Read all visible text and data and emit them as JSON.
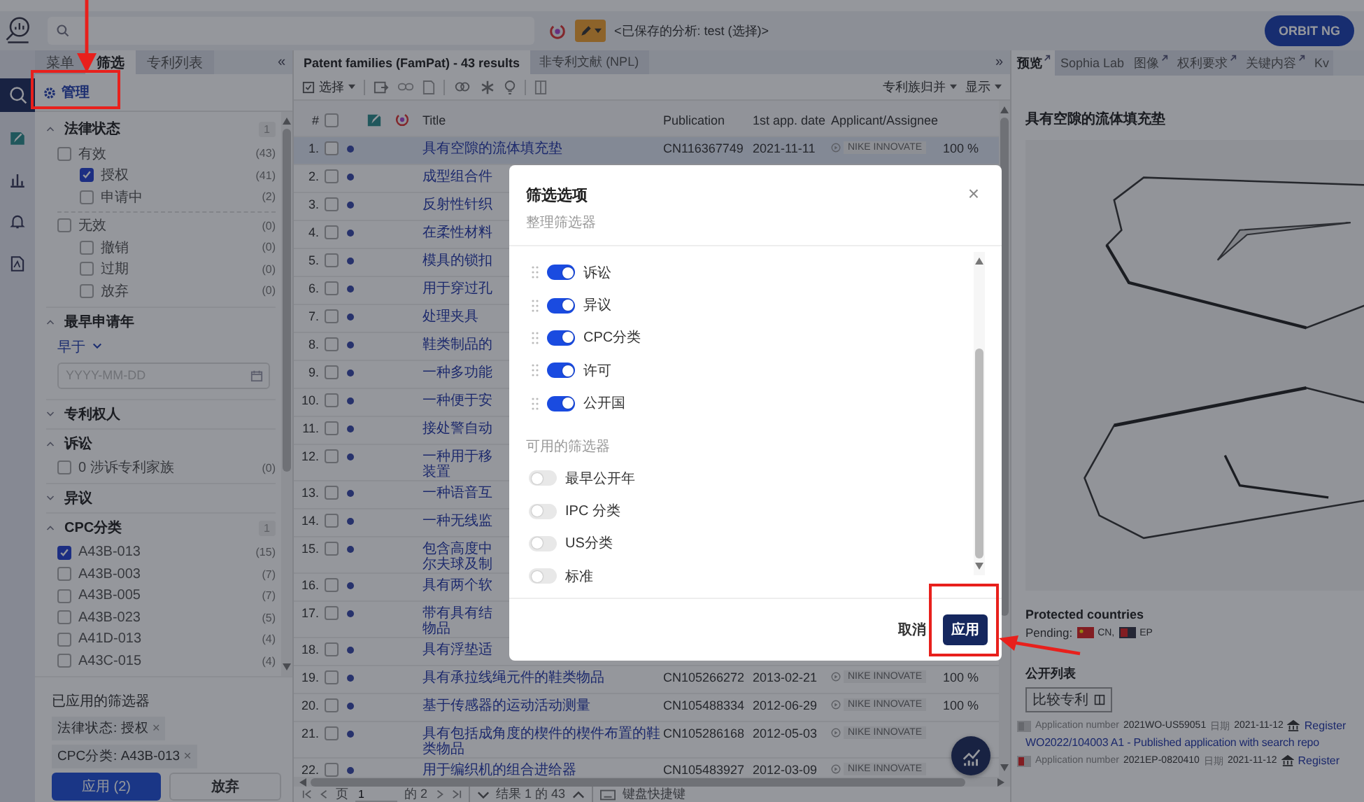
{
  "top_bar": {
    "saved_analysis": "<已保存的分析: test (选择)>",
    "account_button": "ORBIT NG"
  },
  "icon_rail": [
    {
      "selected": true
    },
    {
      "selected": false
    },
    {
      "selected": false
    },
    {
      "selected": false
    },
    {
      "selected": false
    }
  ],
  "filter_panel": {
    "tabs": [
      {
        "label": "菜单",
        "selected": false
      },
      {
        "label": "筛选",
        "selected": true
      },
      {
        "label": "专利列表",
        "selected": false
      }
    ],
    "collapse": "«",
    "manage": {
      "label": "管理",
      "highlighted": true
    },
    "sections": [
      {
        "title": "法律状态",
        "expanded": true,
        "count": "1",
        "kind": "checklist",
        "items": [
          {
            "label": "有效",
            "count": "(43)",
            "checked": false,
            "children": [
              {
                "label": "授权",
                "count": "(41)",
                "checked": true
              },
              {
                "label": "申请中",
                "count": "(2)",
                "checked": false
              }
            ]
          },
          {
            "label": "无效",
            "count": "(0)",
            "checked": false,
            "children": [
              {
                "label": "撤销",
                "count": "(0)",
                "checked": false
              },
              {
                "label": "过期",
                "count": "(0)",
                "checked": false
              },
              {
                "label": "放弃",
                "count": "(0)",
                "checked": false
              }
            ]
          }
        ]
      },
      {
        "title": "最早申请年",
        "expanded": true,
        "kind": "date",
        "mode": "早于",
        "placeholder": "YYYY-MM-DD"
      },
      {
        "title": "专利权人",
        "expanded": false
      },
      {
        "title": "诉讼",
        "expanded": true,
        "kind": "checklist",
        "items": [
          {
            "label": "0 涉诉专利家族",
            "count": "(0)",
            "checked": false
          }
        ]
      },
      {
        "title": "异议",
        "expanded": false
      },
      {
        "title": "CPC分类",
        "expanded": true,
        "count": "1",
        "kind": "checklist",
        "items": [
          {
            "label": "A43B-013",
            "count": "(15)",
            "checked": true
          },
          {
            "label": "A43B-003",
            "count": "(7)",
            "checked": false
          },
          {
            "label": "A43B-005",
            "count": "(7)",
            "checked": false
          },
          {
            "label": "A43B-023",
            "count": "(5)",
            "checked": false
          },
          {
            "label": "A41D-013",
            "count": "(4)",
            "checked": false
          },
          {
            "label": "A43C-015",
            "count": "(4)",
            "checked": false
          }
        ]
      }
    ],
    "applied_title": "已应用的筛选器",
    "applied": [
      {
        "label": "法律状态: 授权",
        "remove": "×"
      },
      {
        "label": "CPC分类: A43B-013",
        "remove": "×"
      }
    ],
    "apply_button": "应用 (2)",
    "discard_button": "放弃"
  },
  "results": {
    "tabs": [
      {
        "label": "Patent families (FamPat) - 43 results",
        "selected": true
      },
      {
        "label": "非专利文献 (NPL)",
        "selected": false
      }
    ],
    "collapse": "»",
    "toolbar": {
      "select": "选择",
      "group": "专利族归并",
      "display": "显示"
    },
    "select_all": {
      "checked": false
    },
    "columns": {
      "number": "#",
      "title": "Title",
      "publication": "Publication",
      "date": "1st app. date",
      "applicant": "Applicant/Assignee"
    },
    "rows": [
      {
        "num": "1.",
        "checked": false,
        "title": "具有空隙的流体填充垫",
        "publication": "CN116367749",
        "date": "2021-11-11",
        "applicant": "NIKE INNOVATE",
        "score": "100 %",
        "selected": true
      },
      {
        "num": "2.",
        "checked": false,
        "title": "成型组合件",
        "selected": false
      },
      {
        "num": "3.",
        "checked": false,
        "title": "反射性针织",
        "selected": false
      },
      {
        "num": "4.",
        "checked": false,
        "title": "在柔性材料",
        "selected": false
      },
      {
        "num": "5.",
        "checked": false,
        "title": "模具的锁扣",
        "selected": false
      },
      {
        "num": "6.",
        "checked": false,
        "title": "用于穿过孔",
        "selected": false
      },
      {
        "num": "7.",
        "checked": false,
        "title": "处理夹具",
        "selected": false
      },
      {
        "num": "8.",
        "checked": false,
        "title": "鞋类制品的",
        "selected": false
      },
      {
        "num": "9.",
        "checked": false,
        "title": "一种多功能",
        "selected": false
      },
      {
        "num": "10.",
        "checked": false,
        "title": "一种便于安",
        "selected": false
      },
      {
        "num": "11.",
        "checked": false,
        "title": "接处警自动",
        "selected": false
      },
      {
        "num": "12.",
        "checked": false,
        "title": "一种用于移装置",
        "selected": false
      },
      {
        "num": "13.",
        "checked": false,
        "title": "一种语音互",
        "selected": false
      },
      {
        "num": "14.",
        "checked": false,
        "title": "一种无线监",
        "selected": false
      },
      {
        "num": "15.",
        "checked": false,
        "title": "包含高度中尔夫球及制",
        "selected": false
      },
      {
        "num": "16.",
        "checked": false,
        "title": "具有两个软",
        "selected": false
      },
      {
        "num": "17.",
        "checked": false,
        "title": "带有具有结物品",
        "selected": false
      },
      {
        "num": "18.",
        "checked": false,
        "title": "具有浮垫适",
        "selected": false
      },
      {
        "num": "19.",
        "checked": false,
        "title": "具有承拉线绳元件的鞋类物品",
        "publication": "CN105266272",
        "date": "2013-02-21",
        "applicant": "NIKE INNOVATE",
        "score": "100 %",
        "selected": false
      },
      {
        "num": "20.",
        "checked": false,
        "title": "基于传感器的运动活动测量",
        "publication": "CN105488334",
        "date": "2012-06-29",
        "applicant": "NIKE INNOVATE",
        "score": "100 %",
        "selected": false
      },
      {
        "num": "21.",
        "checked": false,
        "title": "具有包括成角度的楔件的楔件布置的鞋类物品",
        "publication": "CN105286168",
        "date": "2012-05-03",
        "applicant": "NIKE INNOVATE",
        "selected": false
      },
      {
        "num": "22.",
        "checked": false,
        "title": "用于编织机的组合进给器",
        "publication": "CN105483927",
        "date": "2012-03-09",
        "applicant": "NIKE INNOVATE",
        "selected": false
      }
    ],
    "pagination": {
      "page_label": "页",
      "page": "1",
      "of": "的 2",
      "results": "结果 1 的 43",
      "shortcuts": "键盘快捷键"
    }
  },
  "preview": {
    "tabs": [
      {
        "label": "预览",
        "selected": true,
        "external": true
      },
      {
        "label": "Sophia Lab",
        "selected": false,
        "external": false
      },
      {
        "label": "图像",
        "selected": false,
        "external": true
      },
      {
        "label": "权利要求",
        "selected": false,
        "external": true
      },
      {
        "label": "关键内容",
        "selected": false,
        "external": true
      },
      {
        "label": "Kv",
        "selected": false,
        "external": false
      }
    ],
    "title": "具有空隙的流体填充垫",
    "protected_title": "Protected countries",
    "pending_label": "Pending:",
    "countries": [
      {
        "code": "CN,",
        "kind": "cn"
      },
      {
        "code": "EP",
        "kind": "ep"
      }
    ],
    "publications_title": "公开列表",
    "compare_button": "比较专利",
    "publications": [
      {
        "app_label": "Application number",
        "app_number": "2021WO-US59051",
        "date_label": "日期",
        "date": "2021-11-12",
        "register": "Register",
        "link": "WO2022/104003 A1 - Published application with search repo"
      },
      {
        "app_label": "Application number",
        "app_number": "2021EP-0820410",
        "date_label": "日期",
        "date": "2021-11-12",
        "register": "Register"
      }
    ]
  },
  "dialog": {
    "title": "筛选选项",
    "subtitle": "整理筛选器",
    "close": "×",
    "active": [
      {
        "label": "诉讼",
        "on": true
      },
      {
        "label": "异议",
        "on": true
      },
      {
        "label": "CPC分类",
        "on": true
      },
      {
        "label": "许可",
        "on": true
      },
      {
        "label": "公开国",
        "on": true
      }
    ],
    "available_title": "可用的筛选器",
    "available": [
      {
        "label": "最早公开年",
        "on": false
      },
      {
        "label": "IPC 分类",
        "on": false
      },
      {
        "label": "US分类",
        "on": false
      },
      {
        "label": "标准",
        "on": false
      }
    ],
    "cancel": "取消",
    "apply": {
      "label": "应用",
      "highlighted": true
    }
  }
}
